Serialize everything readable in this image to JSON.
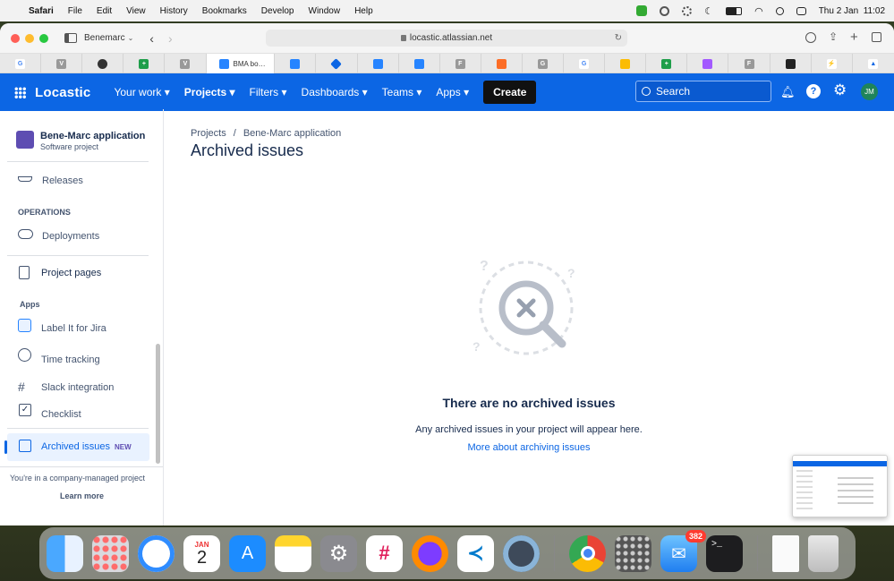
{
  "menubar": {
    "app": "Safari",
    "items": [
      "File",
      "Edit",
      "View",
      "History",
      "Bookmarks",
      "Develop",
      "Window",
      "Help"
    ],
    "clock": "Thu 2 Jan  11:02"
  },
  "browser": {
    "profile": "Benemarc",
    "address": "locastic.atlassian.net",
    "active_tab": "BMA bo…"
  },
  "topnav": {
    "logo": "Locastic",
    "items": [
      "Your work",
      "Projects",
      "Filters",
      "Dashboards",
      "Teams",
      "Apps"
    ],
    "create": "Create",
    "search_placeholder": "Search",
    "avatar": "JM"
  },
  "sidebar": {
    "project_name": "Bene-Marc application",
    "project_type": "Software project",
    "releases": "Releases",
    "operations_heading": "OPERATIONS",
    "deployments": "Deployments",
    "project_pages": "Project pages",
    "apps_heading": "Apps",
    "apps": [
      "Label It for Jira",
      "Time tracking",
      "Slack integration",
      "Checklist"
    ],
    "archived": "Archived issues",
    "new_badge": "NEW",
    "footer": "You're in a company-managed project",
    "learn_more": "Learn more"
  },
  "main": {
    "breadcrumb_projects": "Projects",
    "breadcrumb_sep": "/",
    "breadcrumb_project": "Bene-Marc application",
    "title": "Archived issues",
    "empty_title": "There are no archived issues",
    "empty_desc": "Any archived issues in your project will appear here.",
    "empty_link": "More about archiving issues"
  },
  "dock": {
    "calendar_month": "JAN",
    "calendar_day": "2",
    "mail_badge": "382"
  },
  "colors": {
    "nav_blue": "#0c66e4",
    "link_blue": "#0c66e4",
    "selected_bg": "#e9f2ff",
    "badge_purple": "#5e4db2"
  }
}
